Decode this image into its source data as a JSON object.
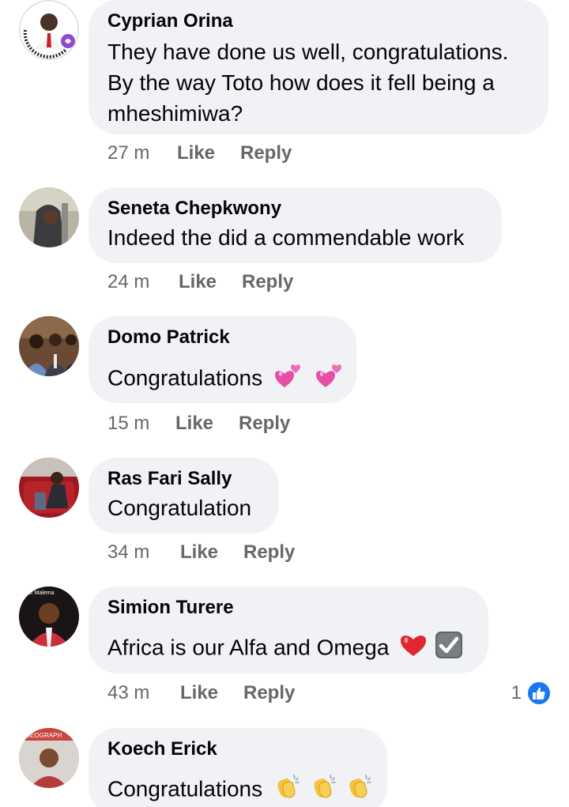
{
  "comments": [
    {
      "author": "Cyprian Orina",
      "text_lines": [
        "They have done us well, congratulations.",
        "By the way Toto how does it fell being a",
        "mheshimiwa?"
      ],
      "time": "27 m",
      "like_label": "Like",
      "reply_label": "Reply",
      "avatar_badge_text": "I GOT MY COVID-19 VACCINE"
    },
    {
      "author": "Seneta Chepkwony",
      "text_lines": [
        "Indeed the did a commendable work"
      ],
      "time": "24 m",
      "like_label": "Like",
      "reply_label": "Reply"
    },
    {
      "author": "Domo Patrick",
      "text_lines": [
        "Congratulations"
      ],
      "emoji": [
        "two-hearts",
        "two-hearts"
      ],
      "time": "15 m",
      "like_label": "Like",
      "reply_label": "Reply"
    },
    {
      "author": "Ras Fari Sally",
      "text_lines": [
        "Congratulation"
      ],
      "time": "34 m",
      "like_label": "Like",
      "reply_label": "Reply"
    },
    {
      "author": "Simion Turere",
      "text_lines": [
        "Africa is our Alfa and Omega"
      ],
      "emoji": [
        "red-heart",
        "check-box"
      ],
      "time": "43 m",
      "like_label": "Like",
      "reply_label": "Reply",
      "reaction_count": "1",
      "reaction_icon": "thumbs-up-icon",
      "avatar_badge_text": "nior Malema"
    },
    {
      "author": "Koech Erick",
      "text_lines": [
        "Congratulations"
      ],
      "emoji": [
        "clapping-hands",
        "clapping-hands",
        "clapping-hands"
      ],
      "avatar_badge_text": "GEOGRAPH"
    }
  ],
  "colors": {
    "bubble": "#f0f2f5",
    "meta_text": "#65676b",
    "like_blue": "#1877f2",
    "heart_pink": "#e84ea6",
    "heart_red": "#e0262f",
    "clap_yellow": "#f6c13b"
  }
}
